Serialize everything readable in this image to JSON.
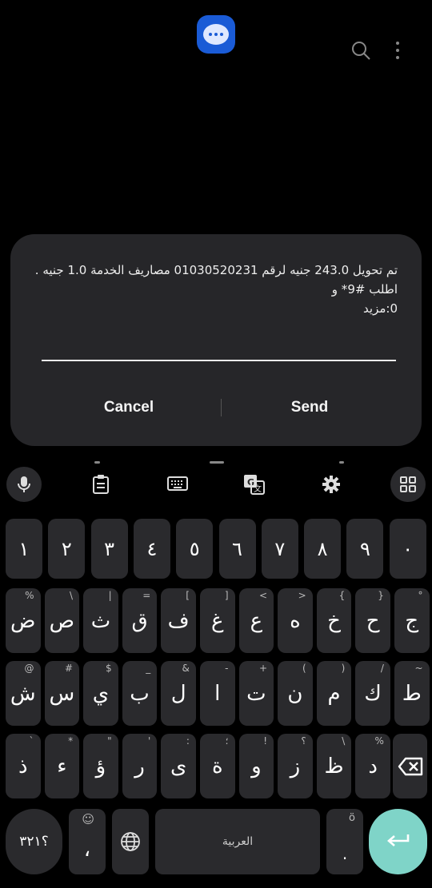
{
  "header": {
    "app_icon": "messages-bubble-icon",
    "search_icon": "search-icon",
    "more_icon": "more-vertical-icon"
  },
  "dialog": {
    "message_line1": "تم تحويل 243.0 جنيه لرقم 01030520231 مصاريف الخدمة 1.0 جنيه .",
    "message_line2": "اطلب #9* و",
    "message_line3": "0:مزيد",
    "input_value": "",
    "cancel_label": "Cancel",
    "send_label": "Send"
  },
  "keyboard": {
    "toolbar": [
      "microphone-icon",
      "clipboard-icon",
      "keyboard-icon",
      "translate-icon",
      "settings-icon",
      "grid-icon"
    ],
    "numbers": [
      "١",
      "٢",
      "٣",
      "٤",
      "٥",
      "٦",
      "٧",
      "٨",
      "٩",
      "٠"
    ],
    "row1": [
      {
        "k": "ض",
        "s": "%"
      },
      {
        "k": "ص",
        "s": "\\"
      },
      {
        "k": "ث",
        "s": "|"
      },
      {
        "k": "ق",
        "s": "="
      },
      {
        "k": "ف",
        "s": "["
      },
      {
        "k": "غ",
        "s": "]"
      },
      {
        "k": "ع",
        "s": "<"
      },
      {
        "k": "ه",
        "s": ">"
      },
      {
        "k": "خ",
        "s": "{"
      },
      {
        "k": "ح",
        "s": "}"
      },
      {
        "k": "ج",
        "s": "°"
      }
    ],
    "row2": [
      {
        "k": "ش",
        "s": "@"
      },
      {
        "k": "س",
        "s": "#"
      },
      {
        "k": "ي",
        "s": "$"
      },
      {
        "k": "ب",
        "s": "_"
      },
      {
        "k": "ل",
        "s": "&"
      },
      {
        "k": "ا",
        "s": "-"
      },
      {
        "k": "ت",
        "s": "+"
      },
      {
        "k": "ن",
        "s": "("
      },
      {
        "k": "م",
        "s": ")"
      },
      {
        "k": "ك",
        "s": "/"
      },
      {
        "k": "ط",
        "s": "~"
      }
    ],
    "row3": [
      {
        "k": "ذ",
        "s": "`"
      },
      {
        "k": "ء",
        "s": "*"
      },
      {
        "k": "ؤ",
        "s": "\""
      },
      {
        "k": "ر",
        "s": "'"
      },
      {
        "k": "ى",
        "s": ":"
      },
      {
        "k": "ة",
        "s": "؛"
      },
      {
        "k": "و",
        "s": "!"
      },
      {
        "k": "ز",
        "s": "؟"
      },
      {
        "k": "ظ",
        "s": "\\"
      },
      {
        "k": "د",
        "s": "%"
      }
    ],
    "symbols_label": "؟٣٢١",
    "emoji_sub": "☺",
    "comma_label": "،",
    "space_label": "العربية",
    "period_label": ".",
    "period_sub": "ö"
  }
}
